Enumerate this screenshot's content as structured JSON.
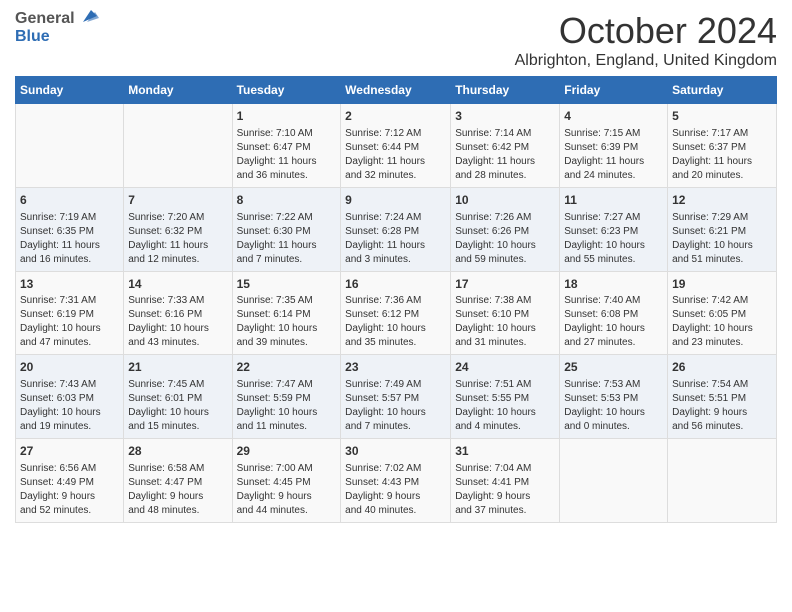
{
  "header": {
    "logo_general": "General",
    "logo_blue": "Blue",
    "month": "October 2024",
    "location": "Albrighton, England, United Kingdom"
  },
  "days_of_week": [
    "Sunday",
    "Monday",
    "Tuesday",
    "Wednesday",
    "Thursday",
    "Friday",
    "Saturday"
  ],
  "weeks": [
    [
      {
        "day": "",
        "info": ""
      },
      {
        "day": "",
        "info": ""
      },
      {
        "day": "1",
        "info": "Sunrise: 7:10 AM\nSunset: 6:47 PM\nDaylight: 11 hours\nand 36 minutes."
      },
      {
        "day": "2",
        "info": "Sunrise: 7:12 AM\nSunset: 6:44 PM\nDaylight: 11 hours\nand 32 minutes."
      },
      {
        "day": "3",
        "info": "Sunrise: 7:14 AM\nSunset: 6:42 PM\nDaylight: 11 hours\nand 28 minutes."
      },
      {
        "day": "4",
        "info": "Sunrise: 7:15 AM\nSunset: 6:39 PM\nDaylight: 11 hours\nand 24 minutes."
      },
      {
        "day": "5",
        "info": "Sunrise: 7:17 AM\nSunset: 6:37 PM\nDaylight: 11 hours\nand 20 minutes."
      }
    ],
    [
      {
        "day": "6",
        "info": "Sunrise: 7:19 AM\nSunset: 6:35 PM\nDaylight: 11 hours\nand 16 minutes."
      },
      {
        "day": "7",
        "info": "Sunrise: 7:20 AM\nSunset: 6:32 PM\nDaylight: 11 hours\nand 12 minutes."
      },
      {
        "day": "8",
        "info": "Sunrise: 7:22 AM\nSunset: 6:30 PM\nDaylight: 11 hours\nand 7 minutes."
      },
      {
        "day": "9",
        "info": "Sunrise: 7:24 AM\nSunset: 6:28 PM\nDaylight: 11 hours\nand 3 minutes."
      },
      {
        "day": "10",
        "info": "Sunrise: 7:26 AM\nSunset: 6:26 PM\nDaylight: 10 hours\nand 59 minutes."
      },
      {
        "day": "11",
        "info": "Sunrise: 7:27 AM\nSunset: 6:23 PM\nDaylight: 10 hours\nand 55 minutes."
      },
      {
        "day": "12",
        "info": "Sunrise: 7:29 AM\nSunset: 6:21 PM\nDaylight: 10 hours\nand 51 minutes."
      }
    ],
    [
      {
        "day": "13",
        "info": "Sunrise: 7:31 AM\nSunset: 6:19 PM\nDaylight: 10 hours\nand 47 minutes."
      },
      {
        "day": "14",
        "info": "Sunrise: 7:33 AM\nSunset: 6:16 PM\nDaylight: 10 hours\nand 43 minutes."
      },
      {
        "day": "15",
        "info": "Sunrise: 7:35 AM\nSunset: 6:14 PM\nDaylight: 10 hours\nand 39 minutes."
      },
      {
        "day": "16",
        "info": "Sunrise: 7:36 AM\nSunset: 6:12 PM\nDaylight: 10 hours\nand 35 minutes."
      },
      {
        "day": "17",
        "info": "Sunrise: 7:38 AM\nSunset: 6:10 PM\nDaylight: 10 hours\nand 31 minutes."
      },
      {
        "day": "18",
        "info": "Sunrise: 7:40 AM\nSunset: 6:08 PM\nDaylight: 10 hours\nand 27 minutes."
      },
      {
        "day": "19",
        "info": "Sunrise: 7:42 AM\nSunset: 6:05 PM\nDaylight: 10 hours\nand 23 minutes."
      }
    ],
    [
      {
        "day": "20",
        "info": "Sunrise: 7:43 AM\nSunset: 6:03 PM\nDaylight: 10 hours\nand 19 minutes."
      },
      {
        "day": "21",
        "info": "Sunrise: 7:45 AM\nSunset: 6:01 PM\nDaylight: 10 hours\nand 15 minutes."
      },
      {
        "day": "22",
        "info": "Sunrise: 7:47 AM\nSunset: 5:59 PM\nDaylight: 10 hours\nand 11 minutes."
      },
      {
        "day": "23",
        "info": "Sunrise: 7:49 AM\nSunset: 5:57 PM\nDaylight: 10 hours\nand 7 minutes."
      },
      {
        "day": "24",
        "info": "Sunrise: 7:51 AM\nSunset: 5:55 PM\nDaylight: 10 hours\nand 4 minutes."
      },
      {
        "day": "25",
        "info": "Sunrise: 7:53 AM\nSunset: 5:53 PM\nDaylight: 10 hours\nand 0 minutes."
      },
      {
        "day": "26",
        "info": "Sunrise: 7:54 AM\nSunset: 5:51 PM\nDaylight: 9 hours\nand 56 minutes."
      }
    ],
    [
      {
        "day": "27",
        "info": "Sunrise: 6:56 AM\nSunset: 4:49 PM\nDaylight: 9 hours\nand 52 minutes."
      },
      {
        "day": "28",
        "info": "Sunrise: 6:58 AM\nSunset: 4:47 PM\nDaylight: 9 hours\nand 48 minutes."
      },
      {
        "day": "29",
        "info": "Sunrise: 7:00 AM\nSunset: 4:45 PM\nDaylight: 9 hours\nand 44 minutes."
      },
      {
        "day": "30",
        "info": "Sunrise: 7:02 AM\nSunset: 4:43 PM\nDaylight: 9 hours\nand 40 minutes."
      },
      {
        "day": "31",
        "info": "Sunrise: 7:04 AM\nSunset: 4:41 PM\nDaylight: 9 hours\nand 37 minutes."
      },
      {
        "day": "",
        "info": ""
      },
      {
        "day": "",
        "info": ""
      }
    ]
  ]
}
